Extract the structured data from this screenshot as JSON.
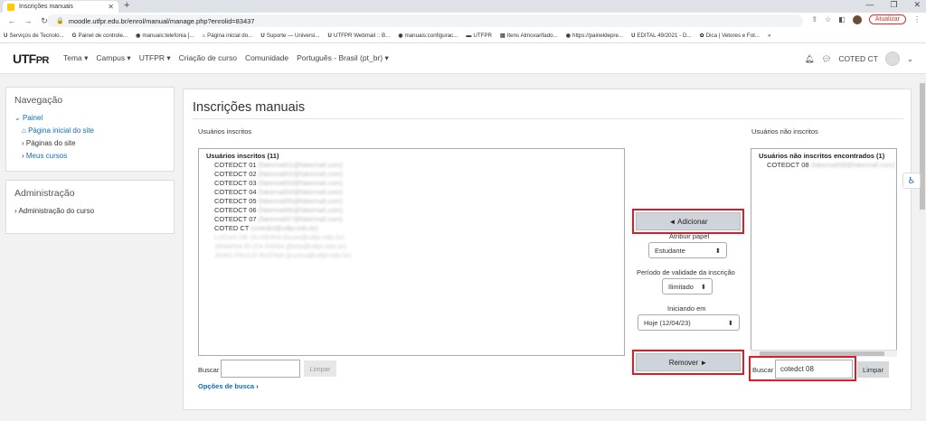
{
  "browser": {
    "tab_title": "Inscrições manuais",
    "url": "moodle.utfpr.edu.br/enrol/manual/manage.php?enrolid=83437",
    "update_label": "Atualizar",
    "bookmarks": [
      "Serviços de Tecnolo...",
      "Painel de controle...",
      "manuais:telefonia [...",
      "Página inicial do...",
      "Suporte — Universi...",
      "UTFPR Webmail :: B...",
      "manuais:configurac...",
      "UTFPR",
      "Itens Almoxarifado...",
      "https://paineldepre...",
      "EDITAL 49/2021 - D...",
      "Dica | Vetores e Fot..."
    ]
  },
  "navbar": {
    "logo_main": "UTF",
    "logo_accent": "PR",
    "menu": [
      "Tema ▾",
      "Campus ▾",
      "UTFPR ▾",
      "Criação de curso",
      "Comunidade",
      "Português - Brasil (pt_br) ▾"
    ],
    "user_name": "COTED CT"
  },
  "nav_block": {
    "title": "Navegação",
    "painel": "Painel",
    "home": "Página inicial do site",
    "site_pages": "Páginas do site",
    "my_courses": "Meus cursos"
  },
  "admin_block": {
    "title": "Administração",
    "course_admin": "Administração do curso"
  },
  "main": {
    "title": "Inscrições manuais",
    "enrolled_label": "Usuários inscritos",
    "not_enrolled_label": "Usuários não inscritos",
    "enrolled_header": "Usuários inscritos (11)",
    "enrolled_users": [
      {
        "name": "COTEDCT 01",
        "email": "(fakemail01@fakemail.com)"
      },
      {
        "name": "COTEDCT 02",
        "email": "(fakemail02@fakemail.com)"
      },
      {
        "name": "COTEDCT 03",
        "email": "(fakemail03@fakemail.com)"
      },
      {
        "name": "COTEDCT 04",
        "email": "(fakemail04@fakemail.com)"
      },
      {
        "name": "COTEDCT 05",
        "email": "(fakemail05@fakemail.com)"
      },
      {
        "name": "COTEDCT 06",
        "email": "(fakemail06@fakemail.com)"
      },
      {
        "name": "COTEDCT 07",
        "email": "(fakemail07@fakemail.com)"
      },
      {
        "name": "COTED CT",
        "email": "(cotedct@utfpr.edu.br)"
      }
    ],
    "hidden_users": [
      "LUCAS DE OLIVEIRA (lucas@utfpr.edu.br)",
      "JANAINA ELIZA FARIA (jfaria@utfpr.edu.br)",
      "JOAO PAULO RUZINA (jruzina@utfpr.edu.br)"
    ],
    "not_enrolled_header": "Usuários não inscritos encontrados (1)",
    "not_enrolled_users": [
      {
        "name": "COTEDCT 08",
        "email": "(fakemail08@fakemail.com)"
      }
    ],
    "add_button": "◄ Adicionar",
    "remove_button": "Remover ►",
    "assign_role_label": "Atribuir papel",
    "role_value": "Estudante",
    "duration_label": "Período de validade da inscrição",
    "duration_value": "Ilimitado",
    "start_label": "Iniciando em",
    "start_value": "Hoje (12/04/23)",
    "search_label": "Buscar",
    "clear_label": "Limpar",
    "search_options": "Opções de busca",
    "right_search_value": "cotedct 08"
  }
}
